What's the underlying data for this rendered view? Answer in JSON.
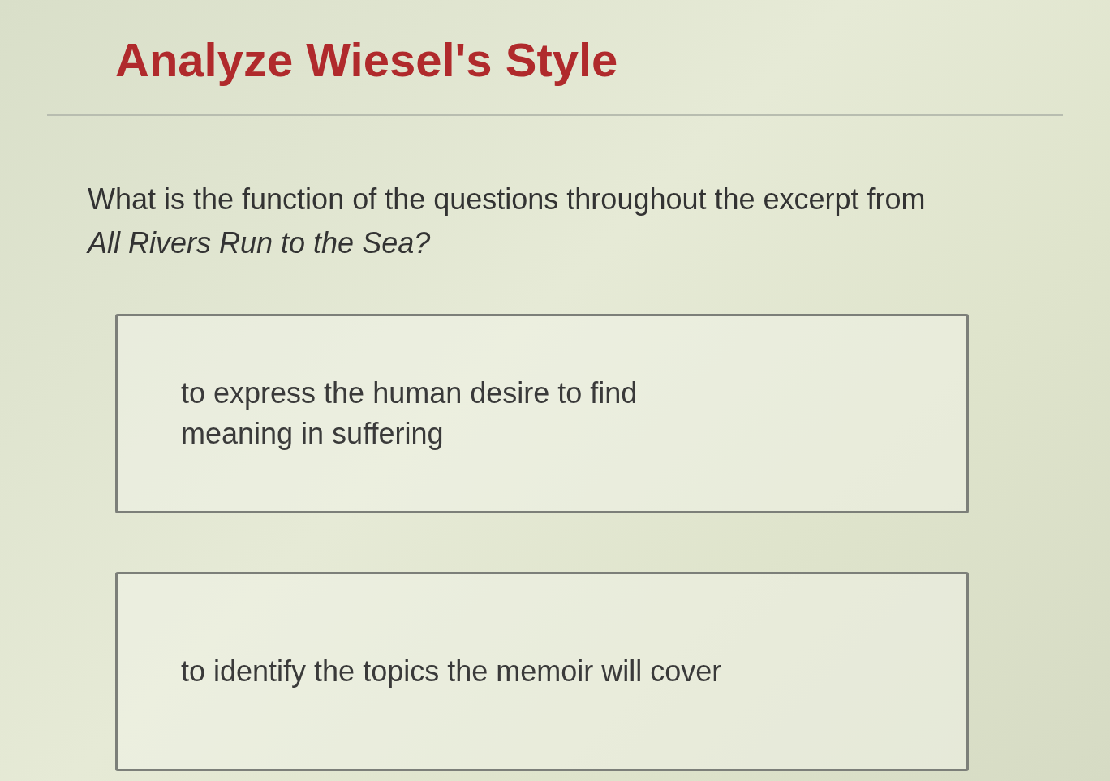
{
  "title": "Analyze Wiesel's Style",
  "question": "What is the function of the questions throughout the excerpt from *All Rivers Run to the Sea?*",
  "options": [
    {
      "text": "to express the human desire to find meaning in suffering"
    },
    {
      "text": "to identify the topics the memoir will cover"
    }
  ]
}
